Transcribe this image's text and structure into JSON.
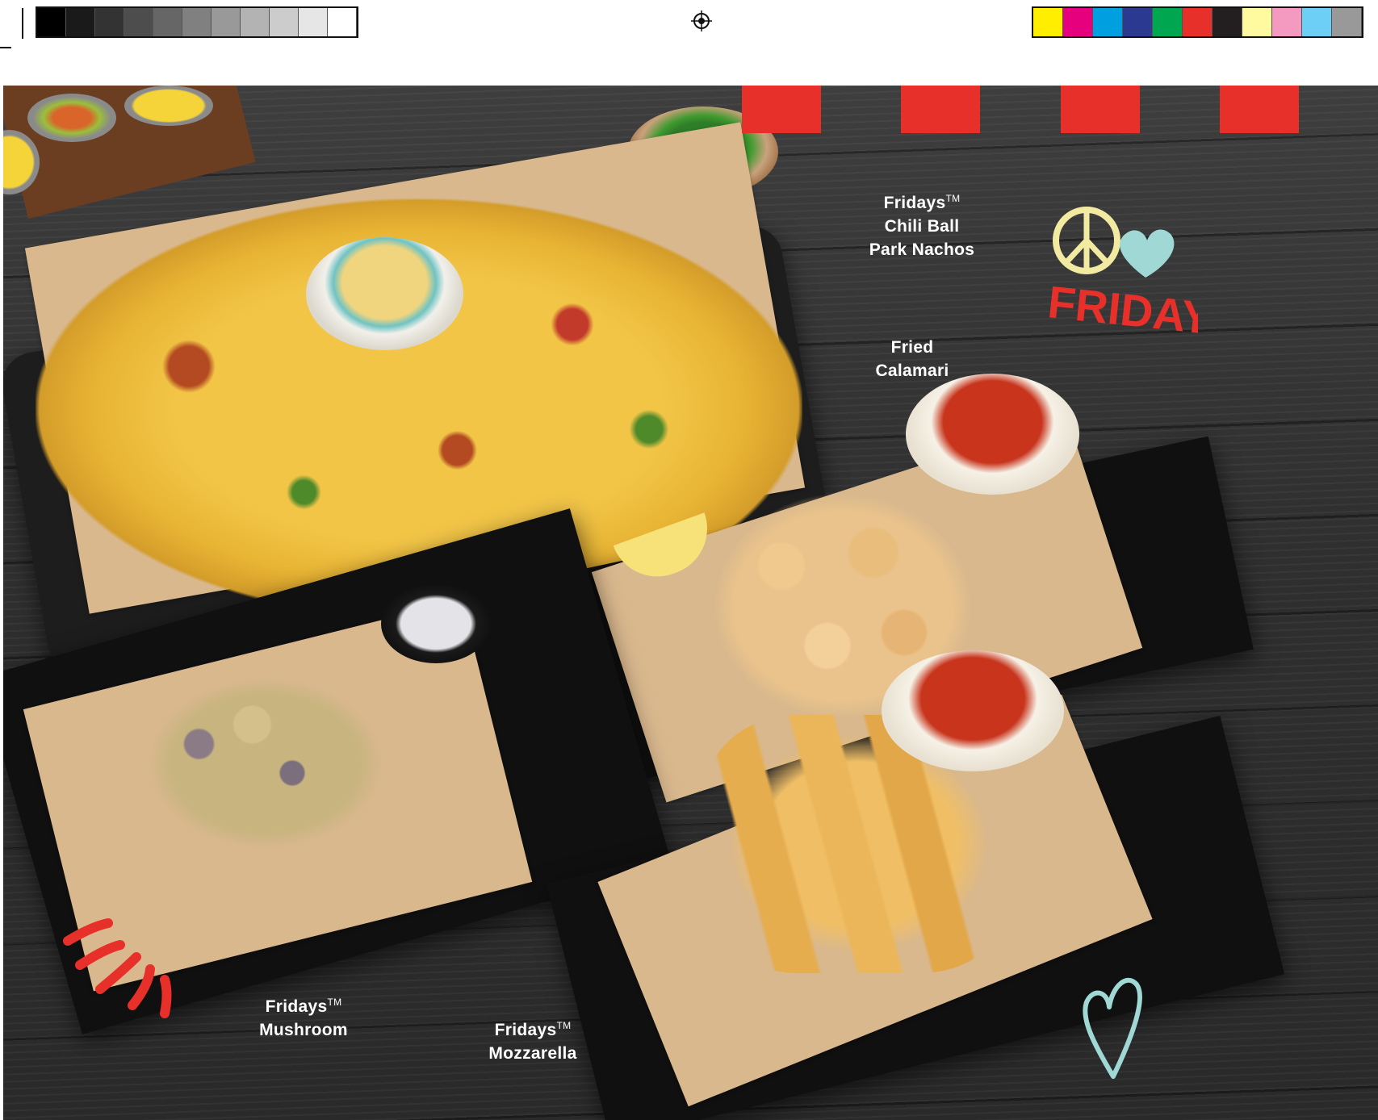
{
  "menu": {
    "items": [
      {
        "name_line1": "Fridays",
        "trademark": "TM",
        "name_line2": "Chili Ball",
        "name_line3": "Park Nachos"
      },
      {
        "name_line1": "Fried",
        "name_line2": "Calamari"
      },
      {
        "name_line1": "Fridays",
        "trademark": "TM",
        "name_line2": "Mushroom"
      },
      {
        "name_line1": "Fridays",
        "trademark": "TM",
        "name_line2": "Mozzarella"
      }
    ]
  },
  "decor": {
    "sticker_text": "FRIDAY",
    "accent_red": "#e8302b",
    "peace_color": "#f2eaa0",
    "heart_color": "#9fd8d4"
  },
  "print_marks": {
    "gray_swatches": [
      "#000000",
      "#1a1a1a",
      "#333333",
      "#4d4d4d",
      "#666666",
      "#808080",
      "#999999",
      "#b3b3b3",
      "#cccccc",
      "#e6e6e6",
      "#ffffff"
    ],
    "color_swatches": [
      "#ffee00",
      "#e6007e",
      "#00a0e0",
      "#2b3990",
      "#00a650",
      "#e8302b",
      "#231f20",
      "#fff9a0",
      "#f49ac1",
      "#6dcff6",
      "#999999"
    ]
  }
}
